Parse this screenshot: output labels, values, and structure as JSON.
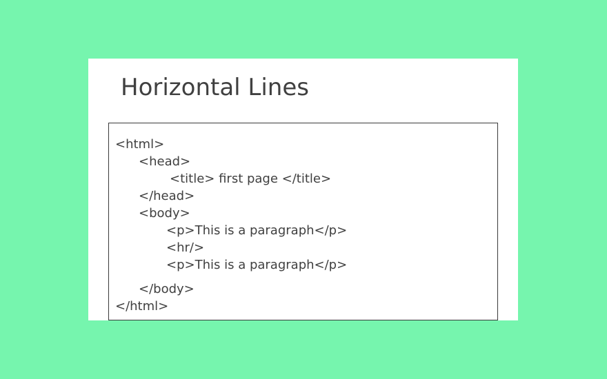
{
  "slide": {
    "title": "Horizontal Lines",
    "code_lines": [
      "<html>",
      "<head>",
      "<title> first page </title>",
      "</head>",
      "<body>",
      "<p>This is a paragraph</p>",
      "<hr/>",
      "<p>This is a paragraph</p>",
      "</body>",
      "</html>"
    ]
  },
  "colors": {
    "background": "#76f5ae",
    "slide": "#ffffff",
    "text": "#404040",
    "border": "#3a3a3a"
  }
}
